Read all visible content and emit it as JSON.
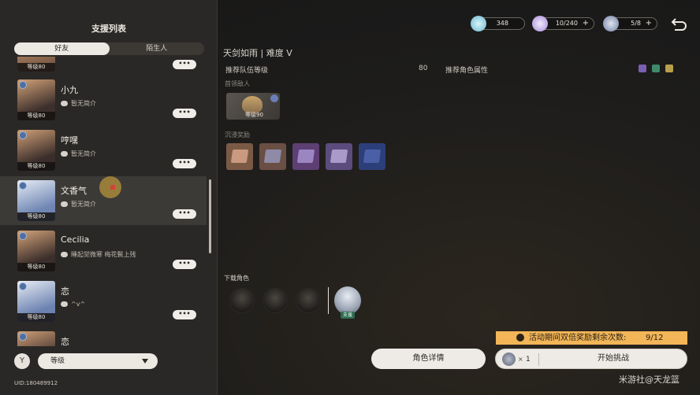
{
  "support_list": {
    "title": "支援列表",
    "tabs": [
      {
        "label": "好友",
        "active": true
      },
      {
        "label": "陌生人",
        "active": false
      }
    ],
    "items": [
      {
        "name": "",
        "signature": "",
        "level": "等级80",
        "more": "•••"
      },
      {
        "name": "小九",
        "signature": "暂无简介",
        "level": "等级80",
        "more": "•••"
      },
      {
        "name": "哼嘿",
        "signature": "暂无简介",
        "level": "等级80",
        "more": "•••"
      },
      {
        "name": "文香气",
        "signature": "暂无简介",
        "level": "等级80",
        "more": "•••"
      },
      {
        "name": "Cecilia",
        "signature": "睡起觉微寒 梅花鬓上残",
        "level": "等级80",
        "more": "•••"
      },
      {
        "name": "恋",
        "signature": "^v^",
        "level": "等级80",
        "more": "•••"
      },
      {
        "name": "恋",
        "signature": "",
        "level": "",
        "more": ""
      }
    ],
    "sort_label": "等级",
    "uid": "UID:180489912"
  },
  "resources": [
    {
      "value": "348",
      "plus": "+",
      "color": "#7fc7d9"
    },
    {
      "value": "10/240",
      "plus": "+",
      "color": "#b9a6e0"
    },
    {
      "value": "5/8",
      "plus": "+",
      "color": "#8fa3c7"
    }
  ],
  "stage": {
    "title": "天剑如雨 | 难度 V",
    "rec_level_label": "推荐队伍等级",
    "rec_level_value": "80",
    "rec_attr_label": "推荐角色属性",
    "attr_colors": [
      "#7a5fb0",
      "#3f8a6a",
      "#b8a04a"
    ],
    "boss_label": "首领敌人",
    "boss_level": "等级90",
    "rewards_label": "沉浸奖励",
    "reward_colors": [
      "#7a5a45",
      "#6a4f44",
      "#5d3f73",
      "#5c4b7d",
      "#2d3f7a"
    ],
    "team_label": "下载角色",
    "support_tag": "支援"
  },
  "event": {
    "text": "活动期间双倍奖励剩余次数:",
    "count": "9/12"
  },
  "buttons": {
    "detail": "角色详情",
    "start": "开始挑战",
    "mult": "×",
    "qty": "1"
  },
  "watermark": "米游社@天龙篮"
}
